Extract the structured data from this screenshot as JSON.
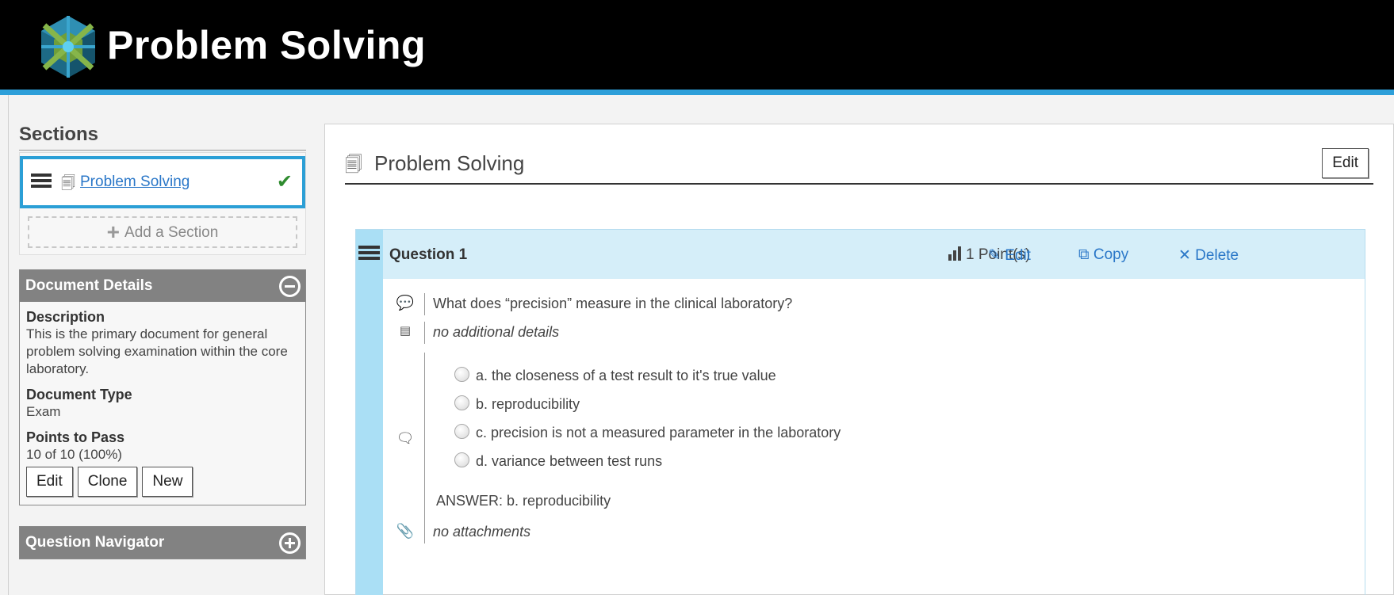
{
  "header": {
    "title": "Problem Solving",
    "logo_icon": "cube-logo-icon"
  },
  "sidebar": {
    "sections_heading": "Sections",
    "section_items": [
      {
        "label": "Problem Solving",
        "completed": true
      }
    ],
    "add_section_label": "Add a Section",
    "document_details": {
      "title": "Document Details",
      "description_label": "Description",
      "description": "This is the primary document for general problem solving examination within the core laboratory.",
      "doc_type_label": "Document Type",
      "doc_type": "Exam",
      "points_label": "Points to Pass",
      "points": "10 of 10 (100%)",
      "buttons": {
        "edit": "Edit",
        "clone": "Clone",
        "new": "New"
      }
    },
    "question_navigator": {
      "title": "Question Navigator"
    }
  },
  "main": {
    "title": "Problem Solving",
    "edit_label": "Edit",
    "question": {
      "title": "Question 1",
      "points": "1 Point(s)",
      "edit": "Edit",
      "copy": "Copy",
      "delete": "Delete",
      "prompt": "What does “precision” measure in the clinical laboratory?",
      "details": "no additional details",
      "options": [
        "a. the closeness of a test result to it's true value",
        "b. reproducibility",
        "c. precision is not a measured parameter in the laboratory",
        "d. variance between test runs"
      ],
      "answer": "ANSWER: b. reproducibility",
      "attachments": "no attachments"
    }
  },
  "colors": {
    "accent": "#2d9fd9",
    "link": "#2a77c8",
    "header_bg": "#000000",
    "panel_head": "#828282",
    "check": "#2e8b2e"
  }
}
